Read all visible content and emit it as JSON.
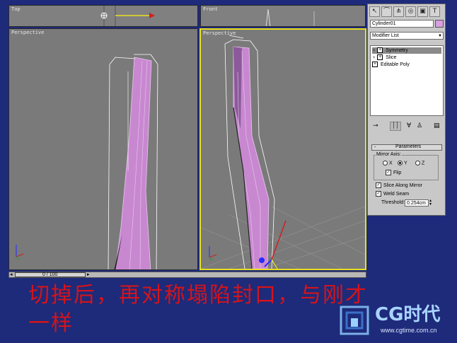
{
  "viewports": {
    "top": "Top",
    "front": "Front",
    "left_perspective": "Perspective",
    "right_perspective": "Perspective"
  },
  "timeline": {
    "frame": "0 / 100"
  },
  "panel": {
    "object_name": "Cylinder01",
    "modifier_list": "Modifier List",
    "stack": [
      "Symmetry",
      "Slice",
      "Editable Poly"
    ],
    "rollout_title": "Parameters",
    "rollout_toggle": "-",
    "mirror_axis_label": "Mirror Axis:",
    "axes": [
      "X",
      "Y",
      "Z"
    ],
    "selected_axis": "Y",
    "flip_label": "Flip",
    "slice_label": "Slice Along Mirror",
    "weld_label": "Weld Seam",
    "threshold_label": "Threshold:",
    "threshold_value": "0.254cm",
    "object_color": "#d8a0e0"
  },
  "caption": {
    "line1": "切掉后，再对称塌陷封口，与刚才",
    "line2": "一样"
  },
  "logo": {
    "brand": "CG时代",
    "url": "www.cgtime.com.cn"
  },
  "colors": {
    "background": "#1e2a7a",
    "caption": "#d4141a",
    "active_border": "#e8e020",
    "mesh": "#c888d0"
  }
}
